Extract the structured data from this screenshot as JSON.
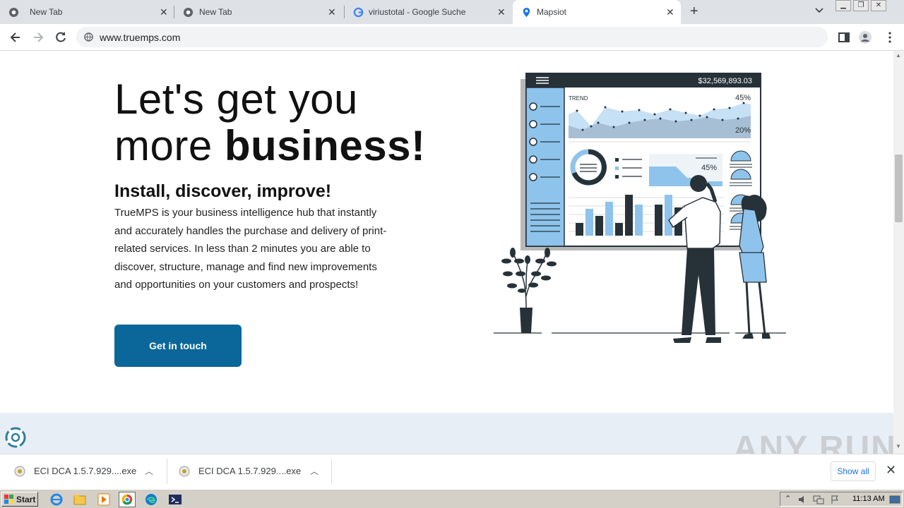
{
  "browser": {
    "tabs": [
      {
        "title": "New Tab",
        "icon": "chrome-icon",
        "active": false
      },
      {
        "title": "New Tab",
        "icon": "chrome-icon",
        "active": false
      },
      {
        "title": "viriustotal - Google Suche",
        "icon": "google-icon",
        "active": false
      },
      {
        "title": "Mapsiot",
        "icon": "map-pin-icon",
        "active": true
      }
    ],
    "url": "www.truemps.com"
  },
  "hero": {
    "line1": "Let's get you",
    "line2_regular": "more ",
    "line2_bold": "business!",
    "subheading": "Install, discover, improve!",
    "paragraph": "TrueMPS is your business intelligence hub that instantly and accurately handles the purchase and delivery of print-related services. In less than 2 minutes you are able to discover, structure, manage and find new improvements and opportunities on your customers and prospects!",
    "cta_label": "Get in touch"
  },
  "illustration": {
    "amount": "$32,569,893.03",
    "trend_label": "TREND",
    "pct_top": "45%",
    "pct_bottom": "20%",
    "pct_area": "45%"
  },
  "downloads": {
    "items": [
      {
        "name": "ECI DCA 1.5.7.929....exe"
      },
      {
        "name": "ECI DCA 1.5.7.929....exe"
      }
    ],
    "show_all": "Show all"
  },
  "watermark": "ANY RUN",
  "taskbar": {
    "start_label": "Start",
    "clock": "11:13 AM"
  },
  "colors": {
    "cta": "#0b6799",
    "band": "#e8eef5",
    "illustration_blue": "#8ec3ec",
    "illustration_dark": "#263238"
  }
}
